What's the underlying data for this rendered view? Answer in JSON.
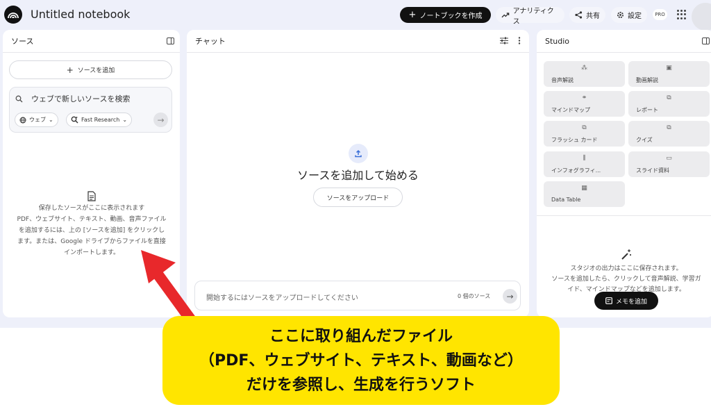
{
  "header": {
    "title": "Untitled notebook",
    "create_label": "ノートブックを作成",
    "analytics_label": "アナリティクス",
    "share_label": "共有",
    "settings_label": "設定",
    "pro_badge": "PRO"
  },
  "sources": {
    "title": "ソース",
    "add_label": "ソースを追加",
    "search_placeholder": "ウェブで新しいソースを検索",
    "chip_web": "ウェブ",
    "chip_research": "Fast Research",
    "empty_title": "保存したソースがここに表示されます",
    "empty_line1": "PDF、ウェブサイト、テキスト、動画、音声ファイル",
    "empty_line2": "を追加するには、上の [ソースを追加] をクリックし",
    "empty_line3": "ます。または、Google ドライブからファイルを直接",
    "empty_line4": "インポートします。"
  },
  "chat": {
    "title": "チャット",
    "start_title": "ソースを追加して始める",
    "upload_label": "ソースをアップロード",
    "input_placeholder": "開始するにはソースをアップロードしてください",
    "source_count": "0 個のソース"
  },
  "studio": {
    "title": "Studio",
    "tiles": [
      {
        "label": "音声解説",
        "icon": "waveform-icon"
      },
      {
        "label": "動画解説",
        "icon": "video-icon"
      },
      {
        "label": "マインドマップ",
        "icon": "mindmap-icon"
      },
      {
        "label": "レポート",
        "icon": "report-icon"
      },
      {
        "label": "フラッシュ カード",
        "icon": "flashcard-icon"
      },
      {
        "label": "クイズ",
        "icon": "quiz-icon"
      },
      {
        "label": "インフォグラフィ...",
        "icon": "infographic-icon"
      },
      {
        "label": "スライド資料",
        "icon": "slides-icon"
      },
      {
        "label": "Data Table",
        "icon": "table-icon"
      }
    ],
    "empty_line1": "スタジオの出力はここに保存されます。",
    "empty_line2": "ソースを追加したら、クリックして音声解説、学習ガ",
    "empty_line3": "イド、マインドマップなどを追加します。",
    "memo_label": "メモを追加"
  },
  "annotation": {
    "line1": "ここに取り組んだファイル",
    "line2": "（PDF、ウェブサイト、テキスト、動画など）",
    "line3": "だけを参照し、生成を行うソフト",
    "arrow_color": "#e8282b",
    "callout_color": "#ffe500"
  }
}
